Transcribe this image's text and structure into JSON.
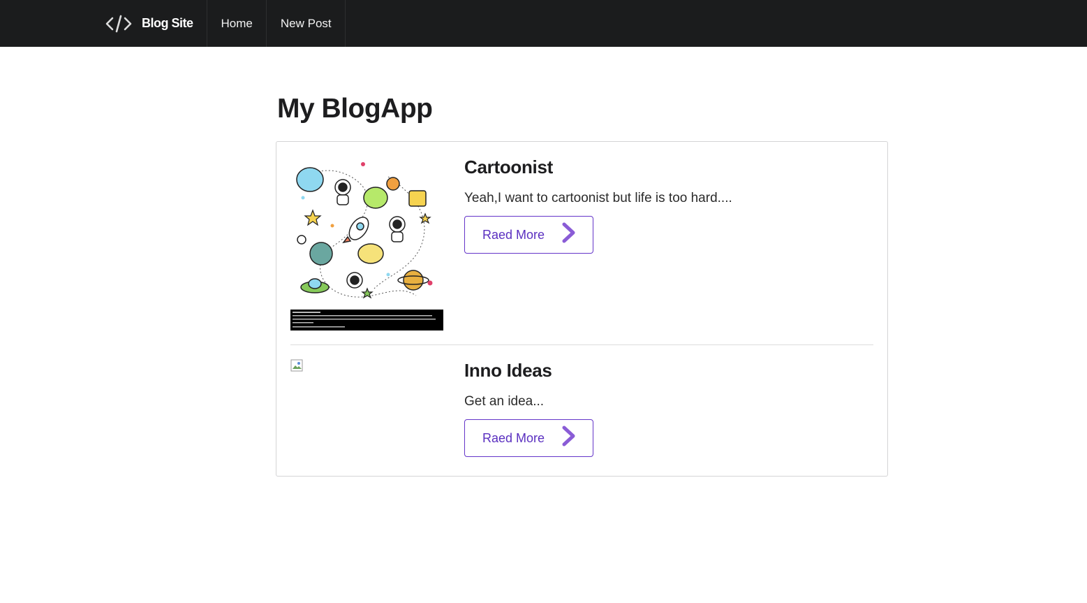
{
  "navbar": {
    "brand_icon": "code-icon",
    "brand_label": "Blog Site",
    "items": [
      {
        "label": "Home"
      },
      {
        "label": "New Post"
      }
    ]
  },
  "main": {
    "title": "My BlogApp",
    "posts": [
      {
        "title": "Cartoonist",
        "excerpt": "Yeah,I want to cartoonist but life is too hard....",
        "button_label": "Raed More",
        "button_icon": "chevron-right-icon",
        "image": "space-doodle-illustration"
      },
      {
        "title": "Inno Ideas",
        "excerpt": "Get an idea...",
        "button_label": "Raed More",
        "button_icon": "chevron-right-icon",
        "image": "broken-image-icon"
      }
    ]
  },
  "colors": {
    "navbar_bg": "#1b1c1d",
    "accent": "#6435c9",
    "chevron": "#8a5cd6"
  }
}
